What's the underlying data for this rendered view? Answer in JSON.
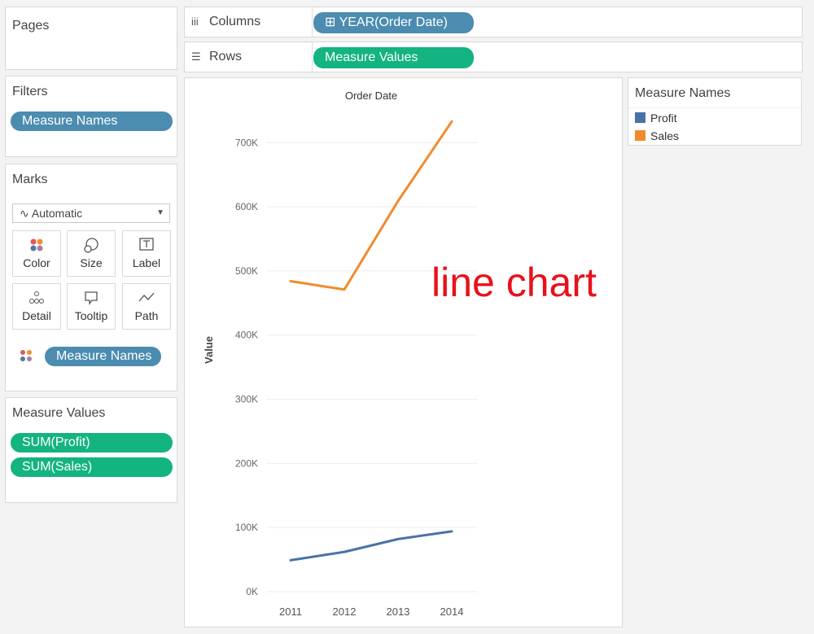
{
  "pages": {
    "title": "Pages"
  },
  "filters": {
    "title": "Filters",
    "pill": "Measure Names"
  },
  "marks": {
    "title": "Marks",
    "type_select": {
      "value": "Automatic"
    },
    "buttons": {
      "color": "Color",
      "size": "Size",
      "label": "Label",
      "detail": "Detail",
      "tooltip": "Tooltip",
      "path": "Path"
    },
    "color_pill": "Measure Names"
  },
  "measure_values": {
    "title": "Measure Values",
    "items": [
      "SUM(Profit)",
      "SUM(Sales)"
    ]
  },
  "shelves": {
    "columns": {
      "label": "Columns",
      "pill": "YEAR(Order Date)"
    },
    "rows": {
      "label": "Rows",
      "pill": "Measure Values"
    }
  },
  "legend": {
    "title": "Measure Names",
    "items": [
      {
        "name": "Profit",
        "color": "#4a72a6"
      },
      {
        "name": "Sales",
        "color": "#f08b2c"
      }
    ]
  },
  "overlay_text": "line chart",
  "chart_data": {
    "type": "line",
    "title": "Order Date",
    "xlabel": "",
    "ylabel": "Value",
    "x": [
      "2011",
      "2012",
      "2013",
      "2014"
    ],
    "ylim": [
      0,
      760000
    ],
    "yticks": [
      0,
      100000,
      200000,
      300000,
      400000,
      500000,
      600000,
      700000
    ],
    "ytick_labels": [
      "0K",
      "100K",
      "200K",
      "300K",
      "400K",
      "500K",
      "600K",
      "700K"
    ],
    "grid": true,
    "series": [
      {
        "name": "Sales",
        "color": "#f08b2c",
        "values": [
          484000,
          471000,
          609000,
          733000
        ]
      },
      {
        "name": "Profit",
        "color": "#4a72a6",
        "values": [
          49000,
          62000,
          82000,
          94000
        ]
      }
    ]
  }
}
